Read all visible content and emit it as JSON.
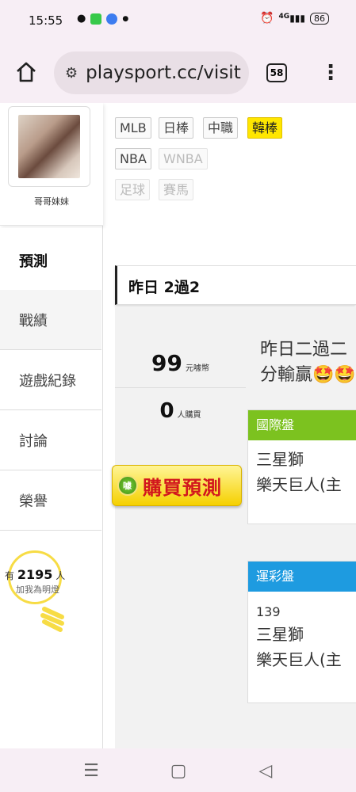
{
  "status_bar": {
    "time": "15:55",
    "battery": "86",
    "network": "4G"
  },
  "browser": {
    "url": "playsport.cc/visit",
    "tab_count": "58"
  },
  "profile": {
    "name": "哥哥妹妹"
  },
  "sidebar": {
    "items": [
      {
        "label": "預測"
      },
      {
        "label": "戰績"
      },
      {
        "label": "遊戲紀錄"
      },
      {
        "label": "討論"
      },
      {
        "label": "榮譽"
      }
    ]
  },
  "fans": {
    "prefix": "有",
    "count": "2195",
    "suffix": "人",
    "subtitle": "加我為明燈"
  },
  "leagues": [
    {
      "label": "MLB"
    },
    {
      "label": "日棒"
    },
    {
      "label": "中職"
    },
    {
      "label": "韓棒"
    },
    {
      "label": "NBA"
    },
    {
      "label": "WNBA"
    },
    {
      "label": "足球"
    },
    {
      "label": "賽馬"
    }
  ],
  "active_league": "韓棒",
  "yesterday_result": "昨日 2過2",
  "prediction": {
    "price": "99",
    "price_unit": "元噱幣",
    "buyers": "0",
    "buyers_unit": "人購買",
    "buy_label": "購買預測",
    "coin_label": "噱",
    "description_1": "昨日二過二",
    "description_2": "分輸贏🤩🤩"
  },
  "international_panel": {
    "title": "國際盤",
    "team_1": "三星獅",
    "team_2": "樂天巨人(主"
  },
  "sports_lottery_panel": {
    "title": "運彩盤",
    "number": "139",
    "team_1": "三星獅",
    "team_2": "樂天巨人(主"
  },
  "colors": {
    "active_tag": "#ffe600",
    "international_head": "#7cc21f",
    "sports_head": "#1e9be0",
    "buy_text": "#d2161d"
  }
}
